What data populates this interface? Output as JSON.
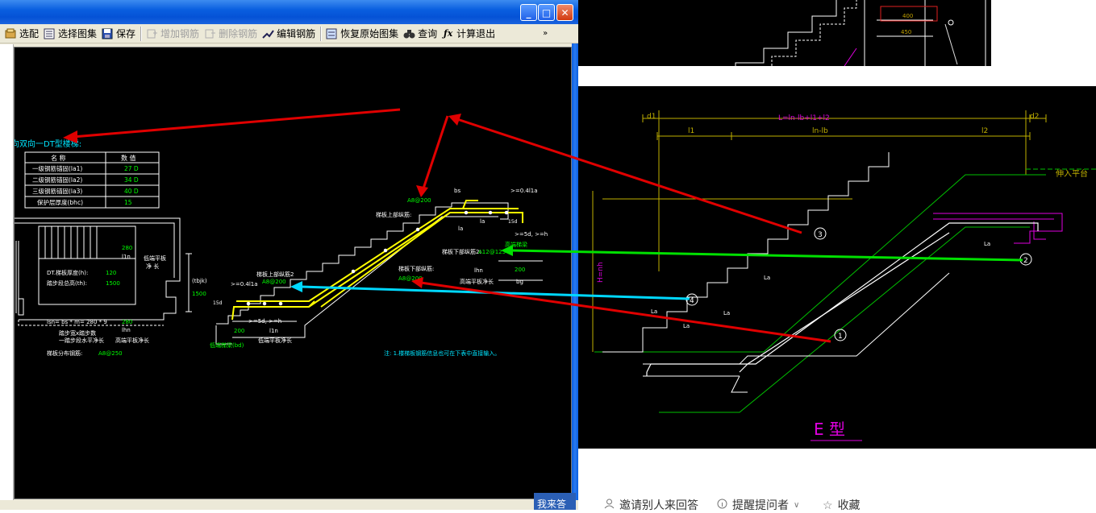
{
  "window": {
    "minimize": "_",
    "maximize": "□",
    "close": "✕"
  },
  "toolbar": {
    "items": [
      {
        "label": "选配",
        "icon": "select-icon",
        "enabled": true
      },
      {
        "label": "选择图集",
        "icon": "atlas-icon",
        "enabled": true
      },
      {
        "label": "保存",
        "icon": "save-icon",
        "enabled": true
      },
      {
        "label": "增加钢筋",
        "icon": "add-rebar-icon",
        "enabled": false
      },
      {
        "label": "删除钢筋",
        "icon": "delete-rebar-icon",
        "enabled": false
      },
      {
        "label": "编辑钢筋",
        "icon": "edit-rebar-icon",
        "enabled": true
      },
      {
        "label": "恢复原始图集",
        "icon": "restore-atlas-icon",
        "enabled": true
      },
      {
        "label": "查询",
        "icon": "binoculars-icon",
        "enabled": true
      },
      {
        "label": "计算退出",
        "icon": "fx-icon",
        "enabled": true
      }
    ],
    "overflow": "»"
  },
  "drawing": {
    "heading": "向双向一DT型楼梯:",
    "table": {
      "headers": [
        "名 称",
        "数 值"
      ],
      "rows": [
        [
          "一级钢筋锚固(la1)",
          "27 D"
        ],
        [
          "二级钢筋锚固(la2)",
          "34 D"
        ],
        [
          "三级钢筋锚固(la3)",
          "40 D"
        ],
        [
          "保护层厚度(bhc)",
          "15"
        ]
      ]
    },
    "labels": {
      "slab_thickness": "DT.梯板厚度(h):",
      "slab_thickness_val": "120",
      "step_height": "踏步段总高(th):",
      "step_height_val": "1500",
      "top_rebar_1": "梯板上部纵筋:",
      "top_rebar_1_val": "A8@200",
      "top_rebar_2": "梯板上部纵筋2",
      "top_rebar_2_val": "A8@200",
      "bottom_rebar_2": "梯板下部纵筋2:",
      "bottom_rebar_2_val": "A12@125",
      "bottom_rebar": "梯板下部纵筋:",
      "bottom_rebar_val": "A8@200",
      "distribution_rebar": "梯板分布钢筋:",
      "distribution_rebar_val": "A8@250",
      "high_end_beam": "高端梯梁",
      "low_end_beam": "低端梯梁(bd)",
      "high_end_span": "高端平板净长",
      "low_end_span": "低端平板净长",
      "high_end_span2": "高端平板净长",
      "low_span_1": "低端平板",
      "low_span_2": "净 长",
      "ln_val": "280",
      "l1n": "l1n",
      "lsn": "lsn= bs * m= 280 * 9",
      "step_text_1": "踏步宽x踏步数",
      "step_text_2": "一踏步段水平净长",
      "v280b": "280",
      "lhn": "lhn",
      "v200": "200",
      "v200b": "200",
      "bg": "bg",
      "bs": "bs",
      "tbjk": "(tbjk)",
      "v1500": "1500",
      "dim_041la": ">=0.4l1a",
      "dim_041la2": ">=0.4l1a",
      "dim_5d": ">=5d, >=h",
      "dim_5d2": ">=5d, >=h",
      "la": "la",
      "la2": "la",
      "v15d": "15d",
      "v15d2": "15d",
      "note": "注: 1.楼梯板钢筋信息也可在下表中直接输入。"
    }
  },
  "reference": {
    "top_labels": [
      "400",
      "450"
    ],
    "dims": [
      "d1",
      "d2",
      "l1",
      "ln-lb",
      "l2",
      "L=ln-lb+l1+l2"
    ],
    "side_label": "H=nh",
    "platform": "伸入平台",
    "circles": [
      "3",
      "2",
      "4",
      "1"
    ],
    "la_labels": [
      "La",
      "La",
      "La",
      "La",
      "La"
    ],
    "type_label": "E 型"
  },
  "qa_bar": {
    "invite": "邀请别人来回答",
    "remind": "提醒提问者",
    "favorite": "收藏",
    "answer_tab": "我来答"
  },
  "colors": {
    "cad_cyan": "#00e5ff",
    "cad_green": "#00ff00",
    "cad_yellow": "#ffff00",
    "cad_magenta": "#ff00ff",
    "arrow_red": "#e00000",
    "arrow_green": "#00e000",
    "arrow_cyan": "#00d8ff",
    "xp_blue": "#0a5fe0"
  }
}
